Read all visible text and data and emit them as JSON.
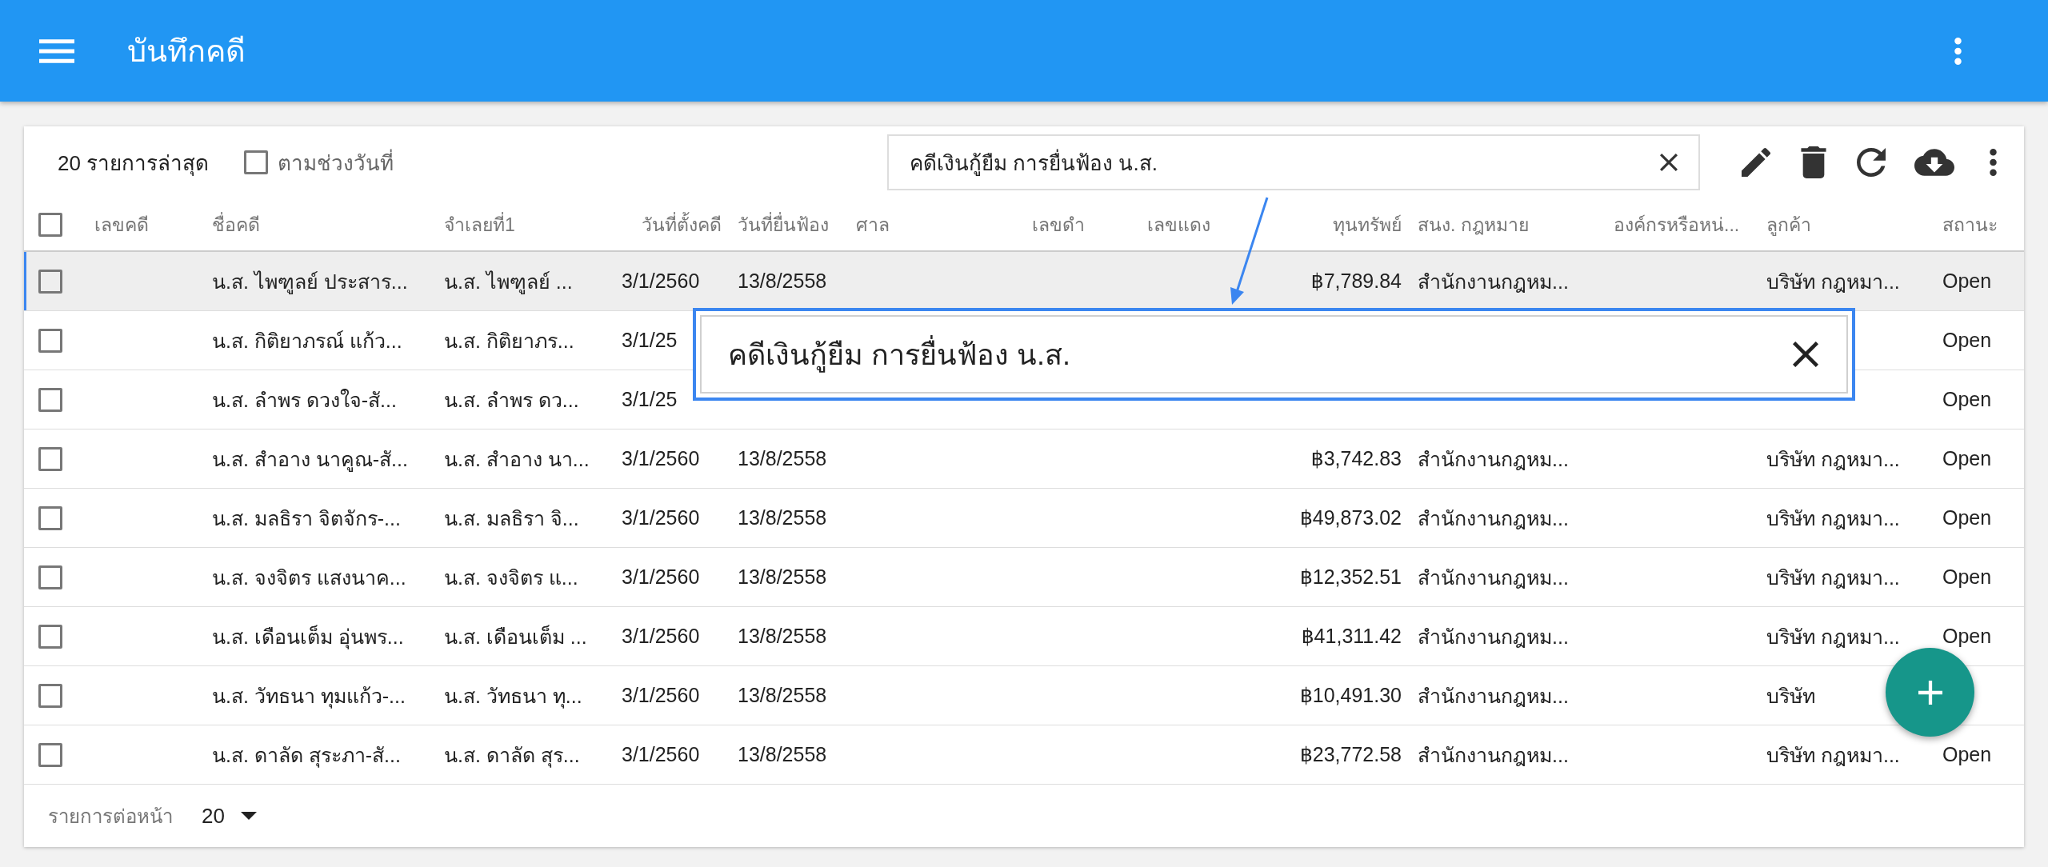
{
  "app_bar": {
    "title": "บันทึกคดี"
  },
  "toolbar": {
    "count_label": "20 รายการล่าสุด",
    "date_range": {
      "label": "ตามช่วงวันที่",
      "checked": false
    },
    "search": {
      "value": "คดีเงินกู้ยืม การยื่นฟ้อง น.ส."
    }
  },
  "table": {
    "header_checked": false,
    "columns": [
      "เลขคดี",
      "ชื่อคดี",
      "จำเลยที่1",
      "วันที่ตั้งคดี",
      "วันที่ยื่นฟ้อง",
      "ศาล",
      "เลขดำ",
      "เลขแดง",
      "ทุนทรัพย์",
      "สนง. กฎหมาย",
      "องค์กรหรือหน่...",
      "ลูกค้า",
      "สถานะ"
    ],
    "rows": [
      {
        "checked": false,
        "highlighted": true,
        "cells": [
          null,
          "น.ส. ไพฑูลย์ ประสาร...",
          "น.ส. ไพฑูลย์ ...",
          "3/1/2560",
          "13/8/2558",
          null,
          null,
          null,
          "฿7,789.84",
          "สำนักงานกฎหม...",
          null,
          "บริษัท กฎหมา...",
          "Open"
        ]
      },
      {
        "checked": false,
        "highlighted": false,
        "cells": [
          null,
          "น.ส. กิติยาภรณ์ แก้ว...",
          "น.ส. กิติยาภร...",
          "3/1/25",
          null,
          null,
          null,
          null,
          null,
          null,
          null,
          null,
          "Open"
        ]
      },
      {
        "checked": false,
        "highlighted": false,
        "cells": [
          null,
          "น.ส. ลำพร ดวงใจ-สั...",
          "น.ส. ลำพร ดว...",
          "3/1/25",
          null,
          null,
          null,
          null,
          null,
          null,
          null,
          null,
          "Open"
        ]
      },
      {
        "checked": false,
        "highlighted": false,
        "cells": [
          null,
          "น.ส. สำอาง นาคูณ-สั...",
          "น.ส. สำอาง นา...",
          "3/1/2560",
          "13/8/2558",
          null,
          null,
          null,
          "฿3,742.83",
          "สำนักงานกฎหม...",
          null,
          "บริษัท กฎหมา...",
          "Open"
        ]
      },
      {
        "checked": false,
        "highlighted": false,
        "cells": [
          null,
          "น.ส. มลธิรา จิตจักร-...",
          "น.ส. มลธิรา จิ...",
          "3/1/2560",
          "13/8/2558",
          null,
          null,
          null,
          "฿49,873.02",
          "สำนักงานกฎหม...",
          null,
          "บริษัท กฎหมา...",
          "Open"
        ]
      },
      {
        "checked": false,
        "highlighted": false,
        "cells": [
          null,
          "น.ส. จงจิตร แสงนาค...",
          "น.ส. จงจิตร แ...",
          "3/1/2560",
          "13/8/2558",
          null,
          null,
          null,
          "฿12,352.51",
          "สำนักงานกฎหม...",
          null,
          "บริษัท กฎหมา...",
          "Open"
        ]
      },
      {
        "checked": false,
        "highlighted": false,
        "cells": [
          null,
          "น.ส. เดือนเต็ม อุ่นพร...",
          "น.ส. เดือนเต็ม ...",
          "3/1/2560",
          "13/8/2558",
          null,
          null,
          null,
          "฿41,311.42",
          "สำนักงานกฎหม...",
          null,
          "บริษัท กฎหมา...",
          "Open"
        ]
      },
      {
        "checked": false,
        "highlighted": false,
        "cells": [
          null,
          "น.ส. วัทธนา ทุมแก้ว-...",
          "น.ส. วัทธนา ทุ...",
          "3/1/2560",
          "13/8/2558",
          null,
          null,
          null,
          "฿10,491.30",
          "สำนักงานกฎหม...",
          null,
          "บริษัท",
          null
        ]
      },
      {
        "checked": false,
        "highlighted": false,
        "cells": [
          null,
          "น.ส. ดาลัด สุระภา-สั...",
          "น.ส. ดาลัด สุร...",
          "3/1/2560",
          "13/8/2558",
          null,
          null,
          null,
          "฿23,772.58",
          "สำนักงานกฎหม...",
          null,
          "บริษัท กฎหมา...",
          "Open"
        ]
      }
    ]
  },
  "footer": {
    "rows_per_page_label": "รายการต่อหน้า",
    "rows_per_page": "20"
  },
  "callout": {
    "text": "คดีเงินกู้ยืม การยื่นฟ้อง น.ส."
  }
}
